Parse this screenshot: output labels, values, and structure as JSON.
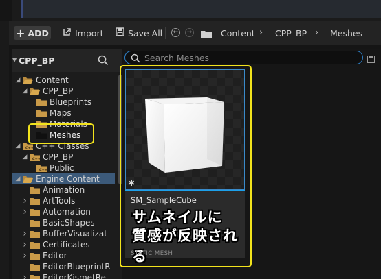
{
  "toolbar": {
    "add_label": "ADD",
    "import_label": "Import",
    "save_all_label": "Save All",
    "breadcrumb": [
      "Content",
      "CPP_BP",
      "Meshes"
    ]
  },
  "sidebar": {
    "title": "CPP_BP",
    "tree": [
      {
        "label": "Content",
        "depth": 0,
        "expanded": true,
        "icon": "folder-open-icon"
      },
      {
        "label": "CPP_BP",
        "depth": 1,
        "expanded": true,
        "icon": "folder-open-icon"
      },
      {
        "label": "Blueprints",
        "depth": 2,
        "icon": "folder-icon"
      },
      {
        "label": "Maps",
        "depth": 2,
        "icon": "folder-icon"
      },
      {
        "label": "Materials",
        "depth": 2,
        "icon": "folder-icon"
      },
      {
        "label": "Meshes",
        "depth": 2,
        "selected": true,
        "icon": "folder-icon"
      },
      {
        "label": "C++ Classes",
        "depth": 0,
        "expanded": true,
        "icon": "cpp-folder-icon"
      },
      {
        "label": "CPP_BP",
        "depth": 1,
        "expanded": true,
        "icon": "cpp-folder-icon"
      },
      {
        "label": "Public",
        "depth": 2,
        "icon": "cpp-folder-icon"
      },
      {
        "label": "Engine Content",
        "depth": 0,
        "expanded": true,
        "icon": "folder-open-icon"
      },
      {
        "label": "Animation",
        "depth": 1,
        "icon": "folder-icon"
      },
      {
        "label": "ArtTools",
        "depth": 1,
        "collapsed": true,
        "icon": "folder-icon"
      },
      {
        "label": "Automation",
        "depth": 1,
        "collapsed": true,
        "icon": "folder-icon"
      },
      {
        "label": "BasicShapes",
        "depth": 1,
        "icon": "folder-icon"
      },
      {
        "label": "BufferVisualizat",
        "depth": 1,
        "collapsed": true,
        "icon": "folder-icon"
      },
      {
        "label": "Certificates",
        "depth": 1,
        "collapsed": true,
        "icon": "folder-icon"
      },
      {
        "label": "Editor",
        "depth": 1,
        "collapsed": true,
        "icon": "folder-icon"
      },
      {
        "label": "EditorBlueprintR",
        "depth": 1,
        "icon": "folder-icon"
      },
      {
        "label": "EditorKismetRe",
        "depth": 1,
        "collapsed": true,
        "icon": "folder-icon"
      }
    ]
  },
  "content": {
    "search_placeholder": "Search Meshes",
    "asset": {
      "name": "SM_SampleCube",
      "type": "STATIC MESH"
    },
    "annotation": {
      "line1": "サムネイルに",
      "line2": "質感が反映される"
    }
  },
  "colors": {
    "accent_blue": "#1ca0ea",
    "highlight_yellow": "#f2e31c",
    "selection": "#3c5a7a"
  }
}
